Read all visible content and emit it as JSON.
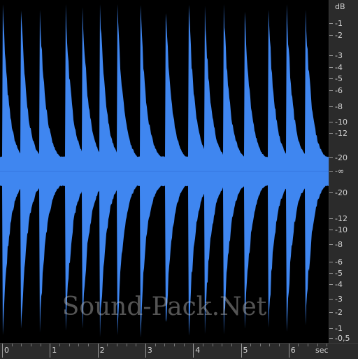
{
  "colors": {
    "waveform": "#3f86f0",
    "waveform_center": "#3a7ee8",
    "background": "#000000",
    "ruler_bg": "#2b2b2b",
    "ruler_text": "#d4d4d4"
  },
  "db_ruler": {
    "unit": "dB",
    "top_labels": [
      "-1",
      "-2",
      "-3",
      "-4",
      "-5",
      "-6",
      "-8",
      "-10",
      "-12",
      "-20"
    ],
    "center_label": "-∞",
    "bottom_labels": [
      "-20",
      "-12",
      "-10",
      "-8",
      "-6",
      "-5",
      "-4",
      "-3",
      "-2",
      "-1",
      "-0,5"
    ]
  },
  "time_ruler": {
    "unit": "sec",
    "labels": [
      "0",
      "1",
      "2",
      "3",
      "4",
      "5",
      "6"
    ]
  },
  "watermark": "Sound-Pack.Net"
}
